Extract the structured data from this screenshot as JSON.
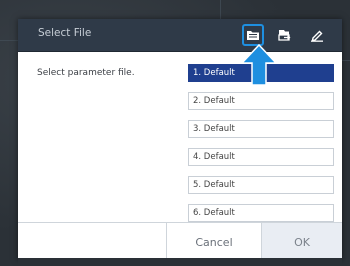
{
  "dialog": {
    "title": "Select File",
    "header_buttons": [
      {
        "icon": "file-open-icon",
        "active": true
      },
      {
        "icon": "file-load-icon",
        "active": false
      },
      {
        "icon": "edit-pen-icon",
        "active": false
      }
    ]
  },
  "main": {
    "label": "Select parameter file.",
    "items": [
      {
        "label": "1. Default",
        "selected": true
      },
      {
        "label": "2. Default",
        "selected": false
      },
      {
        "label": "3. Default",
        "selected": false
      },
      {
        "label": "4. Default",
        "selected": false
      },
      {
        "label": "5. Default",
        "selected": false
      },
      {
        "label": "6. Default",
        "selected": false
      }
    ]
  },
  "footer": {
    "cancel_label": "Cancel",
    "ok_label": "OK"
  },
  "colors": {
    "header_bg": "#2f3a48",
    "selected_bg": "#1f3f8f",
    "highlight": "#1e8fe0"
  }
}
